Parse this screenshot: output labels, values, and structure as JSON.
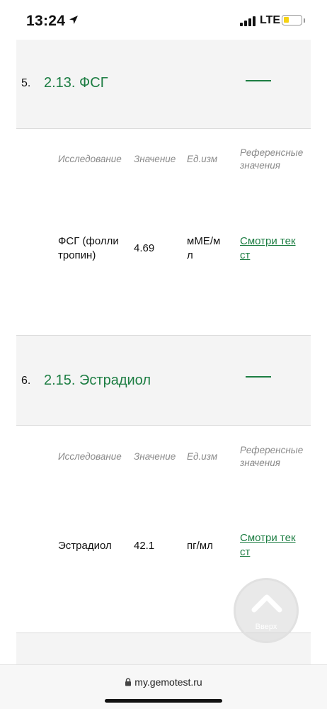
{
  "status": {
    "time": "13:24",
    "network": "LTE"
  },
  "headers": {
    "study": "Исследование",
    "value": "Значение",
    "unit": "Ед.изм",
    "ref_line1": "Референсные",
    "ref_line2": "значения"
  },
  "sections": [
    {
      "num": "5.",
      "title": "2.13. ФСГ",
      "row": {
        "name_line1": "ФСГ (фолли",
        "name_line2": "тропин)",
        "value": "4.69",
        "unit_line1": "мМЕ/м",
        "unit_line2": "л",
        "ref_line1": "Смотри тек",
        "ref_line2": "ст"
      }
    },
    {
      "num": "6.",
      "title": "2.15. Эстрадиол",
      "row": {
        "name_line1": "Эстрадиол",
        "name_line2": "",
        "value": "42.1",
        "unit_line1": "пг/мл",
        "unit_line2": "",
        "ref_line1": "Смотри тек",
        "ref_line2": "ст"
      }
    }
  ],
  "scroll_top": {
    "label": "Вверх"
  },
  "browser": {
    "url": "my.gemotest.ru"
  }
}
